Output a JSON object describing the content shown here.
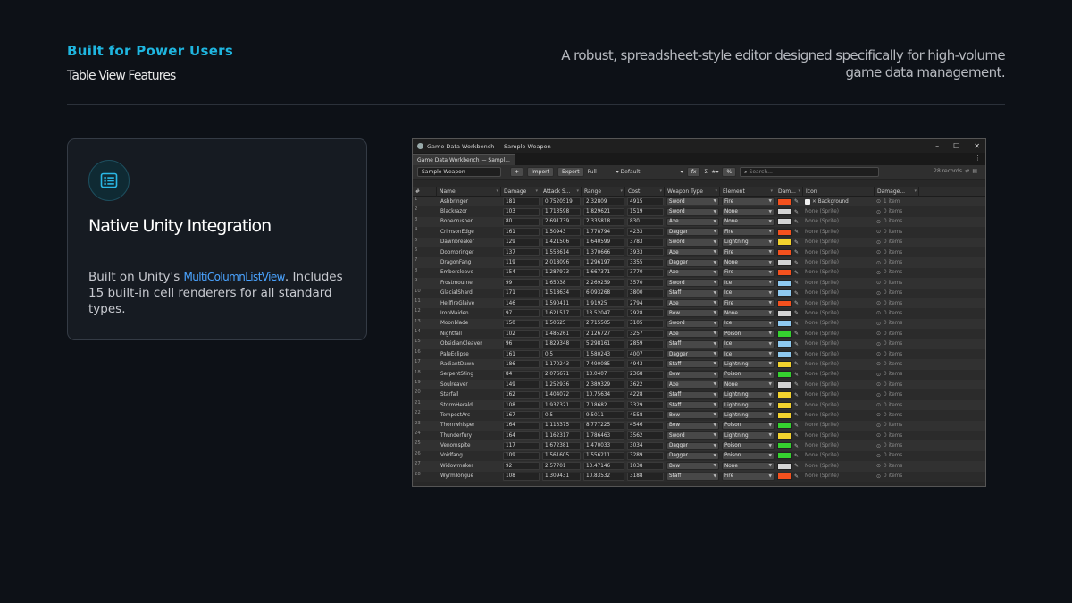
{
  "header": {
    "kicker": "Built for Power Users",
    "subhead": "Table View Features",
    "tagline": "A robust, spreadsheet-style editor designed specifically for high-volume game data management."
  },
  "feature": {
    "icon": "list-icon",
    "title": "Native Unity Integration",
    "desc_pre": "Built on Unity's ",
    "desc_code": "MultiColumnListView",
    "desc_post": ". Includes 15 built-in cell renderers for all standard types."
  },
  "window": {
    "title": "Game Data Workbench — Sample Weapon",
    "tab": "Game Data Workbench — Sampl...",
    "toolbar": {
      "asset_field": "Sample Weapon",
      "add": "+",
      "import": "Import",
      "export": "Export",
      "view": "Full",
      "preset": "Default",
      "fx": "fx",
      "sigma": "Σ",
      "star": "★▾",
      "percent": "%",
      "search_placeholder": "Search...",
      "records": "28 records"
    },
    "columns": [
      "#",
      "Name",
      "Damage",
      "Attack S...",
      "Range",
      "Cost",
      "Weapon Type",
      "Element",
      "Dam...",
      "Icon",
      "Damage..."
    ],
    "element_colors": {
      "Fire": "#f4511e",
      "None": "#d4d4d4",
      "Lightning": "#f2d22e",
      "Ice": "#8ec9f0",
      "Poison": "#35d12f"
    },
    "rows": [
      {
        "n": "1",
        "name": "Ashbringer",
        "dmg": "181",
        "atk": "0.7520519",
        "rng": "2.32809",
        "cost": "4915",
        "type": "Sword",
        "elem": "Fire",
        "icon": "Background",
        "dm": "1 item"
      },
      {
        "n": "2",
        "name": "Blackrazor",
        "dmg": "103",
        "atk": "1.713598",
        "rng": "1.829621",
        "cost": "1519",
        "type": "Sword",
        "elem": "None",
        "icon": "None (Sprite)",
        "dm": "0 items"
      },
      {
        "n": "3",
        "name": "Bonecrusher",
        "dmg": "80",
        "atk": "2.691739",
        "rng": "2.335818",
        "cost": "830",
        "type": "Axe",
        "elem": "None",
        "icon": "None (Sprite)",
        "dm": "0 items"
      },
      {
        "n": "4",
        "name": "CrimsonEdge",
        "dmg": "161",
        "atk": "1.50943",
        "rng": "1.778794",
        "cost": "4233",
        "type": "Dagger",
        "elem": "Fire",
        "icon": "None (Sprite)",
        "dm": "0 items"
      },
      {
        "n": "5",
        "name": "Dawnbreaker",
        "dmg": "129",
        "atk": "1.421506",
        "rng": "1.640599",
        "cost": "3783",
        "type": "Sword",
        "elem": "Lightning",
        "icon": "None (Sprite)",
        "dm": "0 items"
      },
      {
        "n": "6",
        "name": "Doombringer",
        "dmg": "137",
        "atk": "1.553614",
        "rng": "1.370666",
        "cost": "3933",
        "type": "Axe",
        "elem": "Fire",
        "icon": "None (Sprite)",
        "dm": "0 items"
      },
      {
        "n": "7",
        "name": "DragonFang",
        "dmg": "119",
        "atk": "2.018096",
        "rng": "1.296197",
        "cost": "3355",
        "type": "Dagger",
        "elem": "None",
        "icon": "None (Sprite)",
        "dm": "0 items"
      },
      {
        "n": "8",
        "name": "Embercleave",
        "dmg": "154",
        "atk": "1.287973",
        "rng": "1.667371",
        "cost": "3770",
        "type": "Axe",
        "elem": "Fire",
        "icon": "None (Sprite)",
        "dm": "0 items"
      },
      {
        "n": "9",
        "name": "Frostmourne",
        "dmg": "99",
        "atk": "1.65038",
        "rng": "2.269259",
        "cost": "3570",
        "type": "Sword",
        "elem": "Ice",
        "icon": "None (Sprite)",
        "dm": "0 items"
      },
      {
        "n": "10",
        "name": "GlacialShard",
        "dmg": "171",
        "atk": "1.518634",
        "rng": "6.093268",
        "cost": "3800",
        "type": "Staff",
        "elem": "Ice",
        "icon": "None (Sprite)",
        "dm": "0 items"
      },
      {
        "n": "11",
        "name": "HellfireGlaive",
        "dmg": "146",
        "atk": "1.590411",
        "rng": "1.91925",
        "cost": "2794",
        "type": "Axe",
        "elem": "Fire",
        "icon": "None (Sprite)",
        "dm": "0 items"
      },
      {
        "n": "12",
        "name": "IronMaiden",
        "dmg": "97",
        "atk": "1.621517",
        "rng": "13.52047",
        "cost": "2928",
        "type": "Bow",
        "elem": "None",
        "icon": "None (Sprite)",
        "dm": "0 items"
      },
      {
        "n": "13",
        "name": "Moonblade",
        "dmg": "150",
        "atk": "1.50625",
        "rng": "2.715505",
        "cost": "3105",
        "type": "Sword",
        "elem": "Ice",
        "icon": "None (Sprite)",
        "dm": "0 items"
      },
      {
        "n": "14",
        "name": "Nightfall",
        "dmg": "102",
        "atk": "1.485261",
        "rng": "2.126727",
        "cost": "3257",
        "type": "Axe",
        "elem": "Poison",
        "icon": "None (Sprite)",
        "dm": "0 items"
      },
      {
        "n": "15",
        "name": "ObsidianCleaver",
        "dmg": "96",
        "atk": "1.829348",
        "rng": "5.298161",
        "cost": "2859",
        "type": "Staff",
        "elem": "Ice",
        "icon": "None (Sprite)",
        "dm": "0 items"
      },
      {
        "n": "16",
        "name": "PaleEclipse",
        "dmg": "161",
        "atk": "0.5",
        "rng": "1.580243",
        "cost": "4007",
        "type": "Dagger",
        "elem": "Ice",
        "icon": "None (Sprite)",
        "dm": "0 items"
      },
      {
        "n": "17",
        "name": "RadiantDawn",
        "dmg": "186",
        "atk": "1.170243",
        "rng": "7.490085",
        "cost": "4943",
        "type": "Staff",
        "elem": "Lightning",
        "icon": "None (Sprite)",
        "dm": "0 items"
      },
      {
        "n": "18",
        "name": "SerpentSting",
        "dmg": "84",
        "atk": "2.076671",
        "rng": "13.0407",
        "cost": "2368",
        "type": "Bow",
        "elem": "Poison",
        "icon": "None (Sprite)",
        "dm": "0 items"
      },
      {
        "n": "19",
        "name": "Soulreaver",
        "dmg": "149",
        "atk": "1.252936",
        "rng": "2.389329",
        "cost": "3622",
        "type": "Axe",
        "elem": "None",
        "icon": "None (Sprite)",
        "dm": "0 items"
      },
      {
        "n": "20",
        "name": "Starfall",
        "dmg": "162",
        "atk": "1.404072",
        "rng": "10.75634",
        "cost": "4228",
        "type": "Staff",
        "elem": "Lightning",
        "icon": "None (Sprite)",
        "dm": "0 items"
      },
      {
        "n": "21",
        "name": "StormHerald",
        "dmg": "108",
        "atk": "1.937321",
        "rng": "7.18682",
        "cost": "3329",
        "type": "Staff",
        "elem": "Lightning",
        "icon": "None (Sprite)",
        "dm": "0 items"
      },
      {
        "n": "22",
        "name": "TempestArc",
        "dmg": "167",
        "atk": "0.5",
        "rng": "9.5011",
        "cost": "4558",
        "type": "Bow",
        "elem": "Lightning",
        "icon": "None (Sprite)",
        "dm": "0 items"
      },
      {
        "n": "23",
        "name": "Thornwhisper",
        "dmg": "164",
        "atk": "1.113375",
        "rng": "8.777225",
        "cost": "4546",
        "type": "Bow",
        "elem": "Poison",
        "icon": "None (Sprite)",
        "dm": "0 items"
      },
      {
        "n": "24",
        "name": "Thunderfury",
        "dmg": "164",
        "atk": "1.162317",
        "rng": "1.786463",
        "cost": "3562",
        "type": "Sword",
        "elem": "Lightning",
        "icon": "None (Sprite)",
        "dm": "0 items"
      },
      {
        "n": "25",
        "name": "Venomspite",
        "dmg": "117",
        "atk": "1.672381",
        "rng": "1.470033",
        "cost": "3034",
        "type": "Dagger",
        "elem": "Poison",
        "icon": "None (Sprite)",
        "dm": "0 items"
      },
      {
        "n": "26",
        "name": "Voidfang",
        "dmg": "109",
        "atk": "1.561605",
        "rng": "1.556211",
        "cost": "3289",
        "type": "Dagger",
        "elem": "Poison",
        "icon": "None (Sprite)",
        "dm": "0 items"
      },
      {
        "n": "27",
        "name": "Widowmaker",
        "dmg": "92",
        "atk": "2.57701",
        "rng": "13.47146",
        "cost": "1038",
        "type": "Bow",
        "elem": "None",
        "icon": "None (Sprite)",
        "dm": "0 items"
      },
      {
        "n": "28",
        "name": "WyrmTongue",
        "dmg": "108",
        "atk": "1.309431",
        "rng": "10.83532",
        "cost": "3188",
        "type": "Staff",
        "elem": "Fire",
        "icon": "None (Sprite)",
        "dm": "0 items"
      }
    ]
  }
}
